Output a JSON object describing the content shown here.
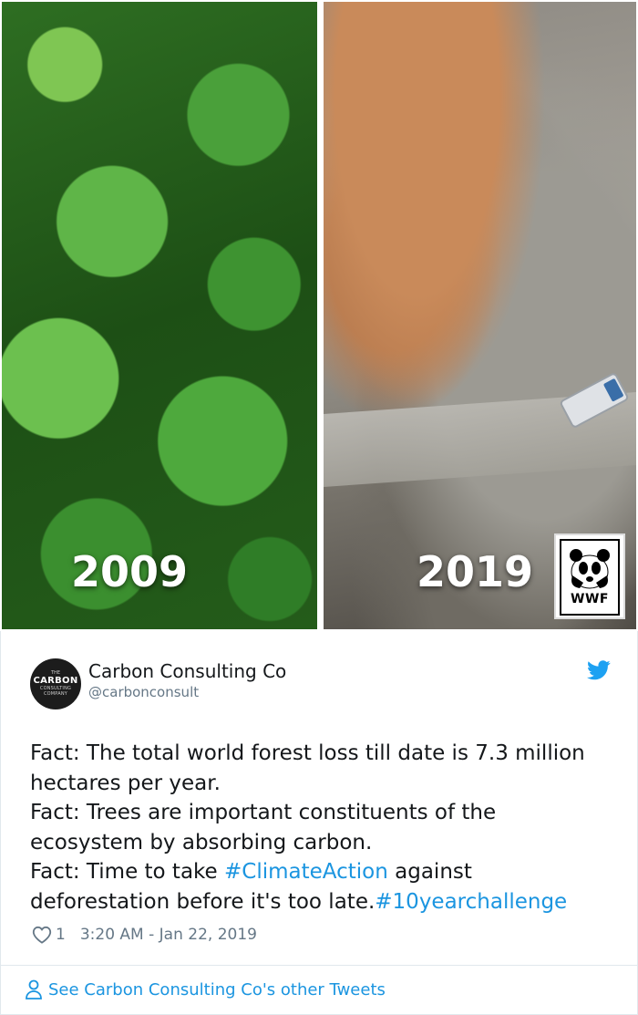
{
  "media": {
    "left_year": "2009",
    "right_year": "2019",
    "logo_text": "WWF"
  },
  "avatar": {
    "line1": "THE",
    "line2": "CARBON",
    "line3": "CONSULTING",
    "line4": "COMPANY"
  },
  "author": {
    "name": "Carbon Consulting Co",
    "handle": "@carbonconsult"
  },
  "tweet": {
    "line1": "Fact: The total world forest loss till date is 7.3 million",
    "line2": "hectares per year.",
    "line3": "Fact: Trees are important constituents of the",
    "line4": "ecosystem by absorbing carbon.",
    "line5_pre": "Fact: Time to take ",
    "hashtag1": "#ClimateAction",
    "line5_post": " against",
    "line6_pre": "deforestation before it's too late.",
    "hashtag2": "#10yearchallenge"
  },
  "meta": {
    "likes": "1",
    "timestamp": "3:20 AM - Jan 22, 2019"
  },
  "footer": {
    "link_label": "See Carbon Consulting Co's other Tweets"
  },
  "colors": {
    "link": "#1b95e0",
    "muted": "#657786",
    "text": "#14171a",
    "twitter_blue": "#1da1f2"
  },
  "icons": [
    "panda-logo-icon",
    "twitter-bird-icon",
    "heart-icon",
    "user-icon"
  ]
}
